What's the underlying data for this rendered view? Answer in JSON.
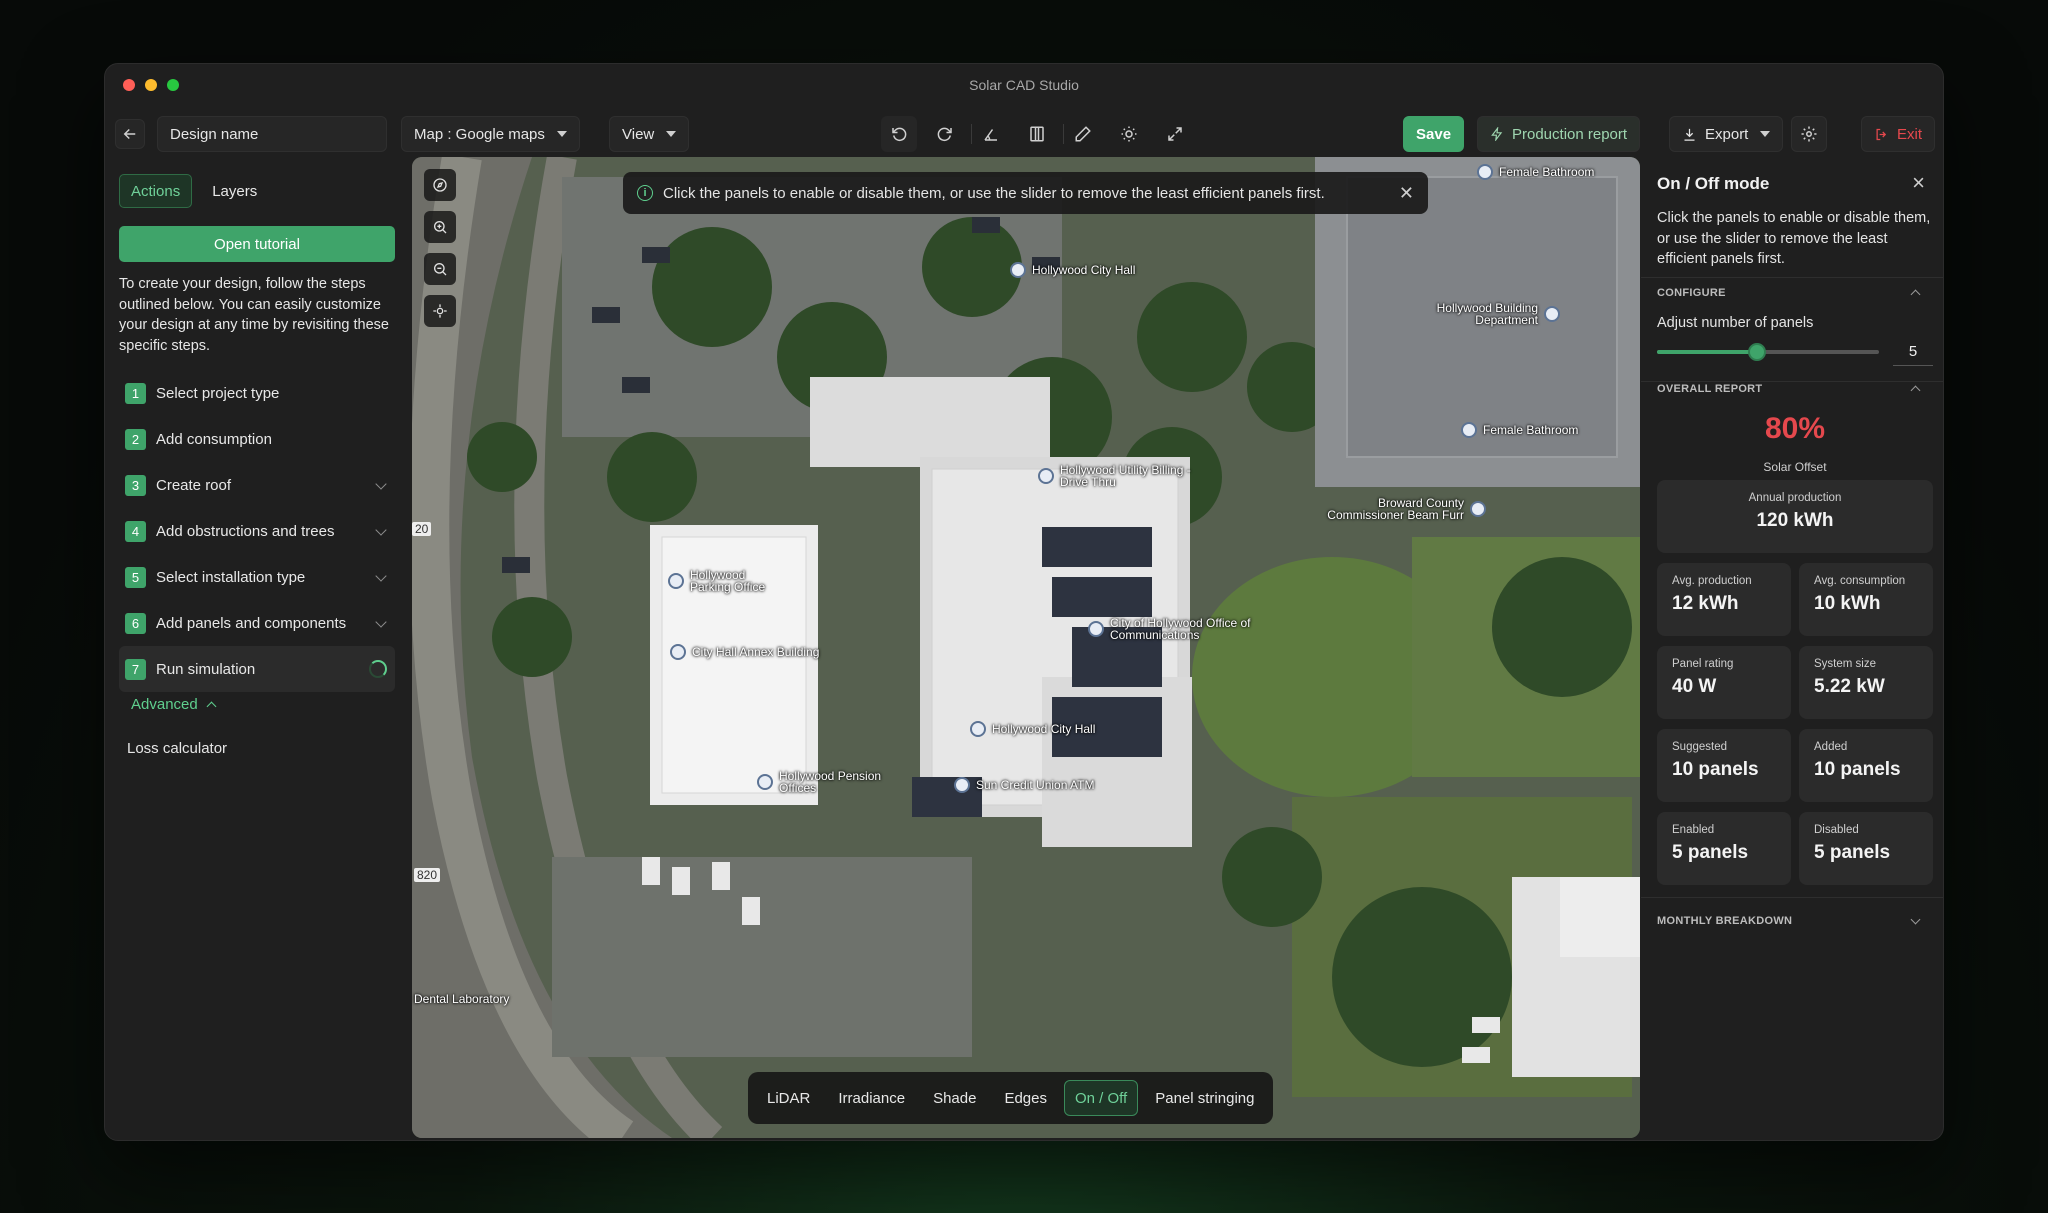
{
  "window": {
    "title": "Solar CAD Studio"
  },
  "toolbar": {
    "design_name": "Design name",
    "map_select": "Map : Google maps",
    "view_select": "View",
    "save_label": "Save",
    "production_report_label": "Production report",
    "export_label": "Export",
    "exit_label": "Exit"
  },
  "sidebar": {
    "tabs": [
      "Actions",
      "Layers"
    ],
    "active_tab": "Actions",
    "tutorial_label": "Open tutorial",
    "intro": "To create your design, follow the steps outlined below. You can easily customize your design at any time by revisiting these specific steps.",
    "steps": [
      {
        "num": "1",
        "label": "Select project type"
      },
      {
        "num": "2",
        "label": "Add consumption"
      },
      {
        "num": "3",
        "label": "Create roof"
      },
      {
        "num": "4",
        "label": "Add obstructions and trees"
      },
      {
        "num": "5",
        "label": "Select installation type"
      },
      {
        "num": "6",
        "label": "Add panels and components"
      },
      {
        "num": "7",
        "label": "Run simulation"
      }
    ],
    "advanced_label": "Advanced",
    "loss_calculator_label": "Loss calculator"
  },
  "map": {
    "banner": "Click the panels to enable or disable them, or use the slider to remove the least efficient panels first.",
    "labels": {
      "female_bathroom_1": "Female Bathroom",
      "city_hall_north": "Hollywood City Hall",
      "building_department": "Hollywood Building Department",
      "female_bathroom_2": "Female Bathroom",
      "utility_billing": "Hollywood Utility Billing - Drive Thru",
      "broward_county": "Broward County Commissioner Beam Furr",
      "parking_office": "Hollywood Parking Office",
      "annex_building": "City Hall Annex Building",
      "communications": "City of Hollywood Office of Communications",
      "city_hall_main": "Hollywood City Hall",
      "sun_credit_union": "Sun Credit Union ATM",
      "pension_offices": "Hollywood Pension Offices",
      "dental_lab": "Dental Laboratory",
      "road_20": "20",
      "road_820": "820"
    },
    "modes": [
      "LiDAR",
      "Irradiance",
      "Shade",
      "Edges",
      "On / Off",
      "Panel stringing"
    ],
    "active_mode": "On / Off"
  },
  "panel": {
    "title": "On / Off mode",
    "description": "Click the panels to enable or disable them, or use the slider to remove the least efficient panels first.",
    "configure_header": "CONFIGURE",
    "adjust_label": "Adjust number of panels",
    "slider_value": "5",
    "slider_fraction": 0.45,
    "overall_header": "OVERALL REPORT",
    "solar_offset_value": "80%",
    "solar_offset_label": "Solar Offset",
    "annual": {
      "label": "Annual production",
      "value": "120 kWh"
    },
    "cards": [
      {
        "label": "Avg. production",
        "value": "12 kWh"
      },
      {
        "label": "Avg. consumption",
        "value": "10 kWh"
      },
      {
        "label": "Panel rating",
        "value": "40 W"
      },
      {
        "label": "System size",
        "value": "5.22 kW"
      },
      {
        "label": "Suggested",
        "value": "10 panels"
      },
      {
        "label": "Added",
        "value": "10 panels"
      },
      {
        "label": "Enabled",
        "value": "5 panels"
      },
      {
        "label": "Disabled",
        "value": "5 panels"
      }
    ],
    "monthly_header": "MONTHLY BREAKDOWN"
  },
  "colors": {
    "accent": "#3fa46a",
    "danger": "#e5484d"
  },
  "icons": [
    "back-arrow-icon",
    "undo-icon",
    "redo-icon",
    "angle-icon",
    "ruler-icon",
    "pencil-icon",
    "sun-icon",
    "expand-icon",
    "bolt-icon",
    "download-icon",
    "gear-icon",
    "exit-icon",
    "compass-icon",
    "zoom-in-icon",
    "zoom-out-icon",
    "locate-icon",
    "info-icon",
    "close-icon"
  ]
}
